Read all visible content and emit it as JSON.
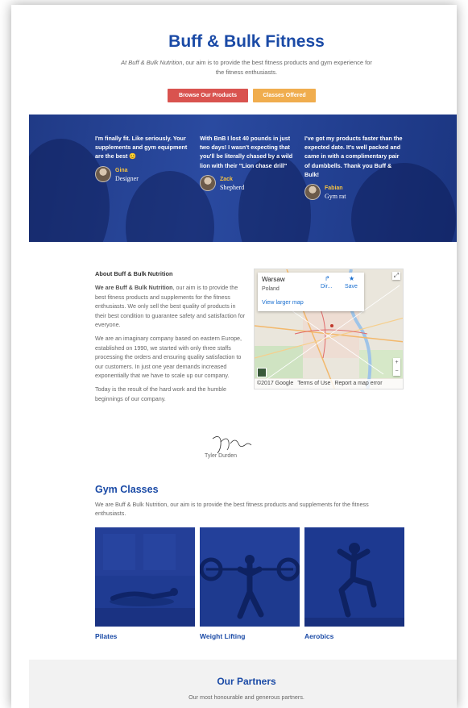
{
  "hero": {
    "title": "Buff & Bulk Fitness",
    "subtitle_brand": "At Buff & Bulk Nutrition",
    "subtitle_rest": ", our aim is to provide the best fitness products and gym experience for the fitness enthusiasts.",
    "browse_label": "Browse Our Products",
    "classes_label": "Classes Offered"
  },
  "colors": {
    "brand_blue": "#1a4aa6",
    "browse_red": "#d9534f",
    "classes_orange": "#f0ad4e",
    "testimonial_bg": "#223f90",
    "name_yellow": "#f6c342"
  },
  "testimonials": [
    {
      "quote": "I'm finally fit. Like seriously. Your supplements and gym equipment are the best 😊",
      "name": "Gina",
      "role": "Designer"
    },
    {
      "quote": "With BnB I lost 40 pounds in just two days! I wasn't expecting that you'll be literally chased by a wild lion with their \"Lion chase drill\"",
      "name": "Zack",
      "role": "Shepherd"
    },
    {
      "quote": "I've got my products faster than the expected date. It's well packed and came in with a complimentary pair of dumbbells. Thank you Buff & Bulk!",
      "name": "Fabian",
      "role": "Gym rat"
    }
  ],
  "about": {
    "heading": "About Buff & Bulk Nutrition",
    "p1_lead": "We are Buff & Bulk Nutrition",
    "p1_rest": ", our aim is to provide the best fitness products and supplements for the fitness enthusiasts. We only sell the best quality of products in their best condition to guarantee safety and satisfaction for everyone.",
    "p2": "We are an imaginary company based on eastern Europe, established on 1990, we started with only three staffs processing the orders and ensuring quality satisfaction to our customers. In just one year demands increased exponentially that we have to scale up our company.",
    "p3": "Today is the result of the hard work and the humble beginnings of our company.",
    "signature_name": "Tyler Durden"
  },
  "map": {
    "city": "Warsaw",
    "country": "Poland",
    "larger_map": "View larger map",
    "directions": "Dir...",
    "save": "Save",
    "footer_copyright": "©2017 Google",
    "footer_terms": "Terms of Use",
    "footer_report": "Report a map error",
    "icons": [
      "directions-icon",
      "save-star-icon",
      "expand-icon",
      "zoom-in-icon",
      "zoom-out-icon"
    ]
  },
  "gym": {
    "title": "Gym Classes",
    "description": "We are Buff & Bulk Nutrition, our aim is to provide the best fitness products and supplements for the fitness enthusiasts.",
    "classes": [
      {
        "label": "Pilates"
      },
      {
        "label": "Weight Lifting"
      },
      {
        "label": "Aerobics"
      }
    ]
  },
  "partners": {
    "title": "Our Partners",
    "subtitle": "Our most honourable and generous partners."
  }
}
